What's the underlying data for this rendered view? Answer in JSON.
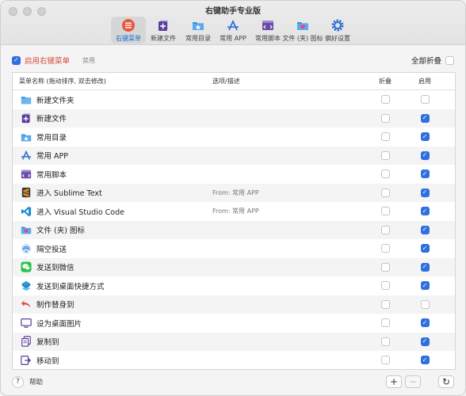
{
  "window": {
    "title": "右键助手专业版"
  },
  "toolbar": [
    {
      "label": "右键菜单",
      "icon": "menu-list-icon",
      "active": true
    },
    {
      "label": "新建文件",
      "icon": "new-file-icon",
      "active": false
    },
    {
      "label": "常用目录",
      "icon": "folder-star-icon",
      "active": false
    },
    {
      "label": "常用 APP",
      "icon": "app-store-icon",
      "active": false
    },
    {
      "label": "常用脚本",
      "icon": "script-icon",
      "active": false
    },
    {
      "label": "文件 (夹) 图标",
      "icon": "folder-heart-icon",
      "active": false
    },
    {
      "label": "偏好设置",
      "icon": "gear-icon",
      "active": false
    }
  ],
  "options": {
    "enable_label": "启用右键菜单",
    "enable_checked": true,
    "disable_label": "禁用",
    "fold_all_label": "全部折叠",
    "fold_all_checked": false
  },
  "table": {
    "headers": {
      "name": "菜单名称 (拖动排序, 双击修改)",
      "options": "选项/描述",
      "fold": "折叠",
      "enable": "启用"
    },
    "rows": [
      {
        "name": "新建文件夹",
        "icon": "folder-icon",
        "desc": "",
        "fold": false,
        "enabled": false
      },
      {
        "name": "新建文件",
        "icon": "new-file-icon",
        "desc": "",
        "fold": false,
        "enabled": true
      },
      {
        "name": "常用目录",
        "icon": "folder-star-icon",
        "desc": "",
        "fold": false,
        "enabled": true
      },
      {
        "name": "常用 APP",
        "icon": "app-store-icon",
        "desc": "",
        "fold": false,
        "enabled": true
      },
      {
        "name": "常用脚本",
        "icon": "script-icon",
        "desc": "",
        "fold": false,
        "enabled": true
      },
      {
        "name": "进入 Sublime Text",
        "icon": "sublime-icon",
        "desc": "From: 常用 APP",
        "fold": false,
        "enabled": true
      },
      {
        "name": "进入 Visual Studio Code",
        "icon": "vscode-icon",
        "desc": "From: 常用 APP",
        "fold": false,
        "enabled": true
      },
      {
        "name": "文件 (夹) 图标",
        "icon": "folder-heart-icon",
        "desc": "",
        "fold": false,
        "enabled": true
      },
      {
        "name": "隔空投送",
        "icon": "airdrop-icon",
        "desc": "",
        "fold": false,
        "enabled": true
      },
      {
        "name": "发送到微信",
        "icon": "wechat-icon",
        "desc": "",
        "fold": false,
        "enabled": true
      },
      {
        "name": "发送到桌面快捷方式",
        "icon": "shortcut-icon",
        "desc": "",
        "fold": false,
        "enabled": true
      },
      {
        "name": "制作替身到",
        "icon": "alias-arrow-icon",
        "desc": "",
        "fold": false,
        "enabled": false
      },
      {
        "name": "设为桌面图片",
        "icon": "desktop-icon",
        "desc": "",
        "fold": false,
        "enabled": true
      },
      {
        "name": "复制到",
        "icon": "copy-icon",
        "desc": "",
        "fold": false,
        "enabled": true
      },
      {
        "name": "移动到",
        "icon": "move-icon",
        "desc": "",
        "fold": false,
        "enabled": true
      }
    ]
  },
  "footer": {
    "help_symbol": "?",
    "help_label": "帮助",
    "add_symbol": "+",
    "remove_symbol": "−",
    "refresh_symbol": "↻"
  }
}
